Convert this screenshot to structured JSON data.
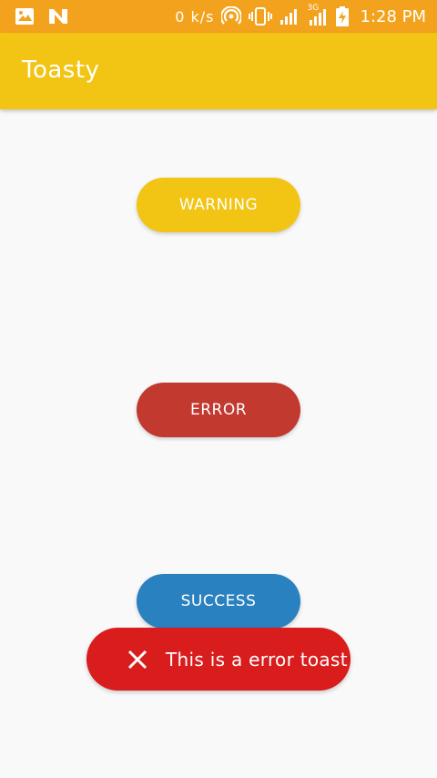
{
  "status_bar": {
    "speed": "0 k/s",
    "network_type": "3G",
    "time": "1:28 PM",
    "background": "#f3a21d",
    "icons": [
      "image-icon",
      "n-icon",
      "hotspot-icon",
      "vibrate-icon",
      "signal-icon",
      "signal-3g-icon",
      "battery-charging-icon"
    ]
  },
  "app_bar": {
    "title": "Toasty",
    "background": "#f2c413"
  },
  "buttons": {
    "warning": {
      "label": "WARNING",
      "color": "#f2c413"
    },
    "error": {
      "label": "ERROR",
      "color": "#c1392f"
    },
    "success": {
      "label": "SUCCESS",
      "color": "#2a81c0"
    }
  },
  "toast": {
    "icon": "close-icon",
    "message": "This is a error toast",
    "color": "#d91c1c"
  }
}
